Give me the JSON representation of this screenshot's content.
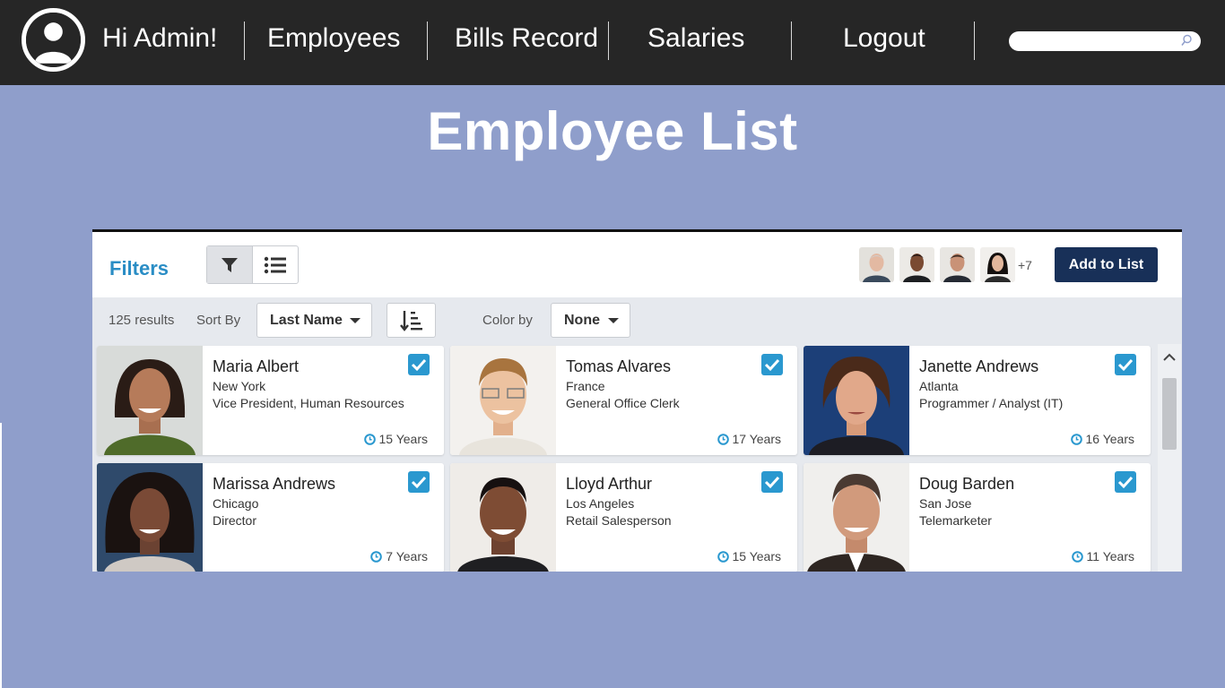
{
  "nav": {
    "greeting": "Hi Admin!",
    "items": [
      {
        "label": "Employees"
      },
      {
        "label": "Bills Record"
      },
      {
        "label": "Salaries"
      },
      {
        "label": "Logout"
      }
    ],
    "search_placeholder": ""
  },
  "page": {
    "title": "Employee List"
  },
  "panel": {
    "filters_title": "Filters",
    "more_count": "+7",
    "add_button": "Add to List",
    "results": "125 results",
    "sort_label": "Sort By",
    "sort_value": "Last Name",
    "color_label": "Color by",
    "color_value": "None"
  },
  "employees": [
    {
      "name": "Maria Albert",
      "city": "New York",
      "role": "Vice President, Human Resources",
      "years": "15 Years",
      "checked": true
    },
    {
      "name": "Tomas Alvares",
      "city": "France",
      "role": "General Office Clerk",
      "years": "17 Years",
      "checked": true
    },
    {
      "name": "Janette Andrews",
      "city": "Atlanta",
      "role": "Programmer / Analyst (IT)",
      "years": "16 Years",
      "checked": true
    },
    {
      "name": "Marissa Andrews",
      "city": "Chicago",
      "role": "Director",
      "years": "7 Years",
      "checked": true
    },
    {
      "name": "Lloyd Arthur",
      "city": "Los Angeles",
      "role": "Retail Salesperson",
      "years": "15 Years",
      "checked": true
    },
    {
      "name": "Doug Barden",
      "city": "San Jose",
      "role": "Telemarketer",
      "years": "11 Years",
      "checked": true
    }
  ],
  "colors": {
    "topbar": "#262626",
    "background": "#8f9ecb",
    "accent": "#2a98cf",
    "filters_title": "#2a8dc5",
    "add_button": "#183058"
  }
}
